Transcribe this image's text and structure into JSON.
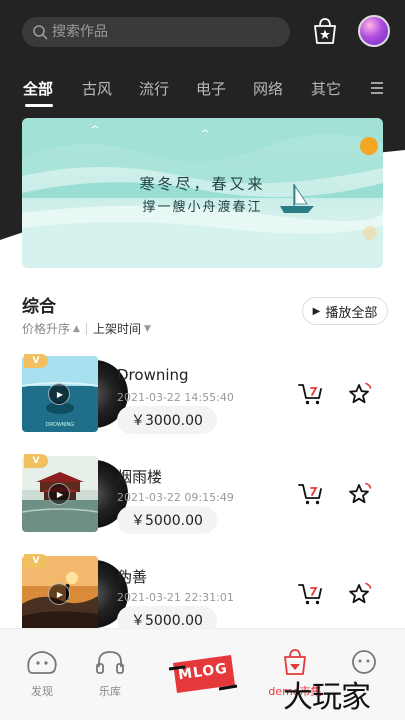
{
  "search": {
    "placeholder": "搜索作品"
  },
  "header": {
    "icons": {
      "bag": "shopping-bag-icon",
      "avatar": "user-avatar"
    }
  },
  "tabs": [
    {
      "label": "全部",
      "active": true
    },
    {
      "label": "古风"
    },
    {
      "label": "流行"
    },
    {
      "label": "电子"
    },
    {
      "label": "网络"
    },
    {
      "label": "其它"
    }
  ],
  "banner": {
    "line1": "寒冬尽，春又来",
    "line2": "撑一艘小舟渡春江",
    "colors": {
      "sea": "#5fcdbd",
      "sun": "#f5a623"
    }
  },
  "section": {
    "title": "综合",
    "sort": [
      {
        "label": "价格升序",
        "arrow": "▲"
      },
      {
        "label": "上架时间",
        "arrow": "▼"
      }
    ],
    "play_all": "播放全部"
  },
  "songs": [
    {
      "name": "Drowning",
      "date": "2021-03-22 14:55:40",
      "price": "￥3000.00",
      "badge": "V"
    },
    {
      "name": "烟雨楼",
      "date": "2021-03-22 09:15:49",
      "price": "￥5000.00",
      "badge": "V"
    },
    {
      "name": "伪善",
      "date": "2021-03-21 22:31:01",
      "price": "￥5000.00",
      "badge": "V"
    }
  ],
  "bottom_nav": {
    "discover": "发现",
    "library": "乐库",
    "mlog": "MLOG",
    "market": "demo市集",
    "mine": ""
  },
  "watermark": "大玩家",
  "accent": "#e5383b"
}
